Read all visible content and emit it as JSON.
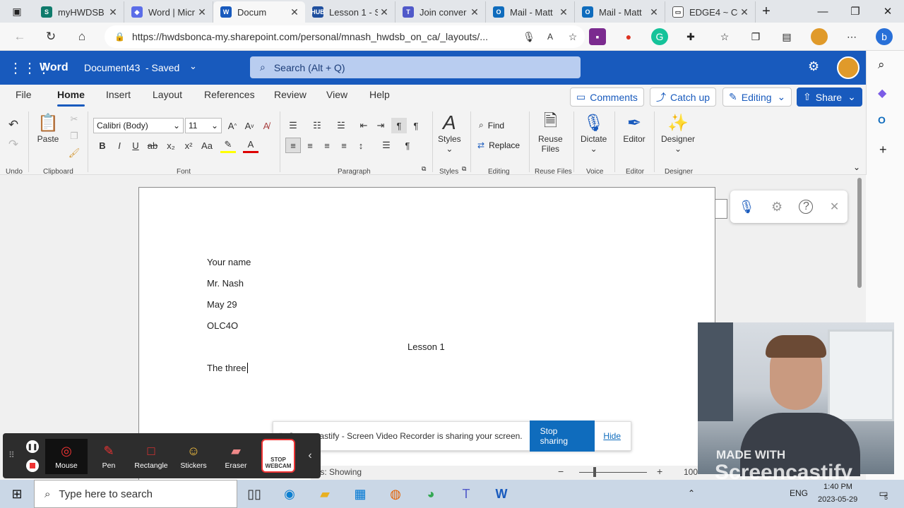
{
  "browser": {
    "tabs": [
      {
        "label": "myHWDSB",
        "color": "#0f7b6c",
        "glyph": "S"
      },
      {
        "label": "Word | Micr",
        "color": "#5b6de8",
        "glyph": "◆"
      },
      {
        "label": "Docum",
        "color": "#185abd",
        "glyph": "W"
      },
      {
        "label": "Lesson 1 - S",
        "color": "#1f4f9e",
        "glyph": "HUB"
      },
      {
        "label": "Join conver",
        "color": "#5059c9",
        "glyph": "T"
      },
      {
        "label": "Mail - Matt",
        "color": "#0f6cbd",
        "glyph": "O"
      },
      {
        "label": "Mail - Matt",
        "color": "#0f6cbd",
        "glyph": "O"
      },
      {
        "label": "EDGE4 ~ Co",
        "color": "#ffffff",
        "glyph": "▭"
      }
    ],
    "new_tab": "+",
    "window_controls": {
      "minimize": "—",
      "restore": "❐",
      "close": "✕"
    },
    "url": "https://hwdsbonca-my.sharepoint.com/personal/mnash_hwdsb_on_ca/_layouts/..."
  },
  "word": {
    "app_name": "Word",
    "doc_title": "Document43",
    "save_state": "- Saved",
    "search_placeholder": "Search (Alt + Q)",
    "menu": [
      "File",
      "Home",
      "Insert",
      "Layout",
      "References",
      "Review",
      "View",
      "Help"
    ],
    "comments_label": "Comments",
    "catchup_label": "Catch up",
    "editing_label": "Editing",
    "share_label": "Share",
    "ribbon": {
      "paste": "Paste",
      "font_name": "Calibri (Body)",
      "font_size": "11",
      "styles": "Styles",
      "find": "Find",
      "replace": "Replace",
      "reuse_files": [
        "Reuse",
        "Files"
      ],
      "dictate": "Dictate",
      "editor": "Editor",
      "designer": "Designer",
      "groups": [
        "Undo",
        "Clipboard",
        "Font",
        "Paragraph",
        "Styles",
        "Editing",
        "Reuse Files",
        "Voice",
        "Editor",
        "Designer"
      ]
    },
    "document_lines": [
      "Your name",
      "Mr. Nash",
      "May 29",
      "OLC4O",
      "Lesson 1",
      "The three"
    ],
    "status_text": "ons: Showing",
    "zoom": "100"
  },
  "sharing": {
    "message": "Screencastify - Screen Video Recorder is sharing your screen.",
    "stop_label": "Stop sharing",
    "hide_label": "Hide"
  },
  "screencastify": {
    "tools": [
      "Mouse",
      "Pen",
      "Rectangle",
      "Stickers",
      "Eraser"
    ],
    "stop_webcam": [
      "STOP",
      "WEBCAM"
    ],
    "watermark_top": "MADE WITH",
    "watermark_bottom": "Screencastify"
  },
  "taskbar": {
    "search_placeholder": "Type here to search",
    "language": "ENG",
    "time": "1:40 PM",
    "date": "2023-05-29",
    "notifications": "5"
  },
  "colors": {
    "word_blue": "#185abd",
    "stop_blue": "#0f6cbd"
  }
}
